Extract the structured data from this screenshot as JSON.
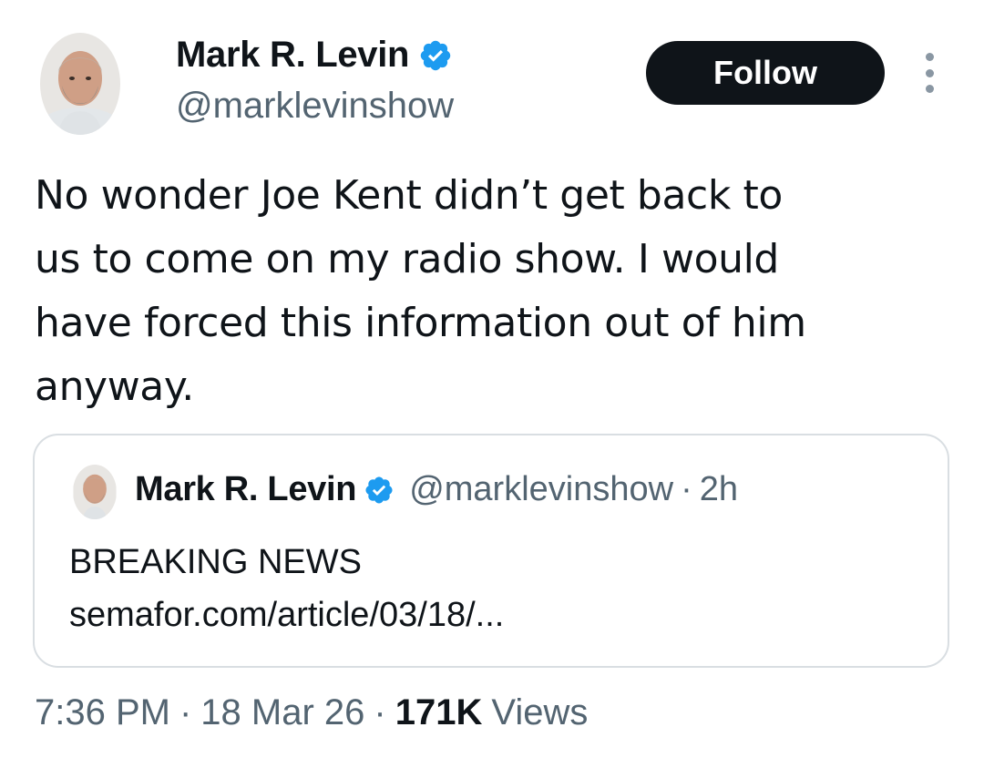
{
  "tweet": {
    "author": {
      "name": "Mark R. Levin",
      "handle": "@marklevinshow",
      "verified_color": "#1d9bf0"
    },
    "follow_label": "Follow",
    "text": "No wonder Joe Kent didn’t get back to\nus to come on my radio show.  I would\nhave forced this information out of him\nanyway.",
    "quote": {
      "author_name": "Mark R. Levin",
      "handle": "@marklevinshow",
      "separator": "·",
      "time": "2h",
      "line1": "BREAKING NEWS",
      "line2": "semafor.com/article/03/18/..."
    },
    "meta": {
      "time": "7:36 PM",
      "sep1": "·",
      "date": "18 Mar 26",
      "sep2": "·",
      "views_count": "171K",
      "views_label": "Views"
    }
  }
}
